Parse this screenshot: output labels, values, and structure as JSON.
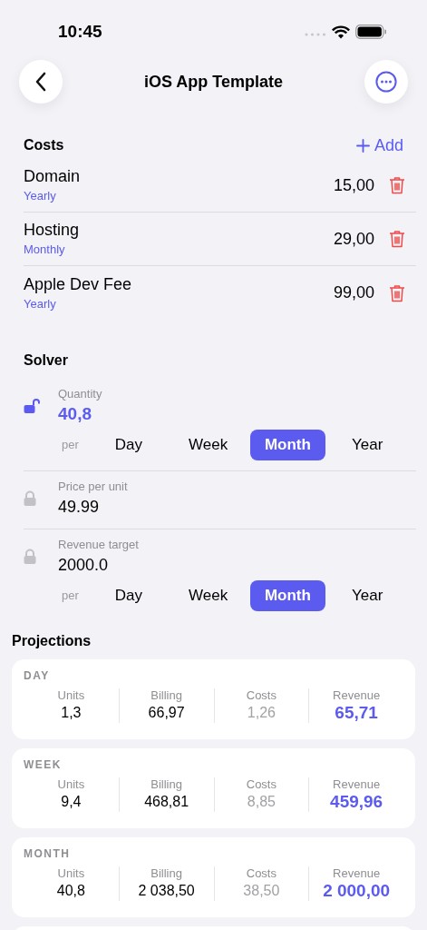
{
  "status_bar": {
    "time": "10:45"
  },
  "nav": {
    "title": "iOS App Template"
  },
  "costs": {
    "title": "Costs",
    "add_label": "Add",
    "items": [
      {
        "name": "Domain",
        "period": "Yearly",
        "amount": "15,00"
      },
      {
        "name": "Hosting",
        "period": "Monthly",
        "amount": "29,00"
      },
      {
        "name": "Apple Dev Fee",
        "period": "Yearly",
        "amount": "99,00"
      }
    ]
  },
  "solver": {
    "title": "Solver",
    "fields": [
      {
        "label": "Quantity",
        "value": "40,8",
        "locked": false,
        "per_label": "per",
        "periods": [
          {
            "label": "Day",
            "selected": false
          },
          {
            "label": "Week",
            "selected": false
          },
          {
            "label": "Month",
            "selected": true
          },
          {
            "label": "Year",
            "selected": false
          }
        ]
      },
      {
        "label": "Price per unit",
        "value": "49.99",
        "locked": true
      },
      {
        "label": "Revenue target",
        "value": "2000.0",
        "locked": true,
        "per_label": "per",
        "periods": [
          {
            "label": "Day",
            "selected": false
          },
          {
            "label": "Week",
            "selected": false
          },
          {
            "label": "Month",
            "selected": true
          },
          {
            "label": "Year",
            "selected": false
          }
        ]
      }
    ]
  },
  "projections": {
    "title": "Projections",
    "cards": [
      {
        "period": "DAY",
        "metrics": [
          {
            "label": "Units",
            "value": "1,3",
            "kind": "plain"
          },
          {
            "label": "Billing",
            "value": "66,97",
            "kind": "plain"
          },
          {
            "label": "Costs",
            "value": "1,26",
            "kind": "muted"
          },
          {
            "label": "Revenue",
            "value": "65,71",
            "kind": "accent"
          }
        ]
      },
      {
        "period": "WEEK",
        "metrics": [
          {
            "label": "Units",
            "value": "9,4",
            "kind": "plain"
          },
          {
            "label": "Billing",
            "value": "468,81",
            "kind": "plain"
          },
          {
            "label": "Costs",
            "value": "8,85",
            "kind": "muted"
          },
          {
            "label": "Revenue",
            "value": "459,96",
            "kind": "accent"
          }
        ]
      },
      {
        "period": "MONTH",
        "metrics": [
          {
            "label": "Units",
            "value": "40,8",
            "kind": "plain"
          },
          {
            "label": "Billing",
            "value": "2 038,50",
            "kind": "plain"
          },
          {
            "label": "Costs",
            "value": "38,50",
            "kind": "muted"
          },
          {
            "label": "Revenue",
            "value": "2 000,00",
            "kind": "accent"
          }
        ]
      }
    ]
  }
}
